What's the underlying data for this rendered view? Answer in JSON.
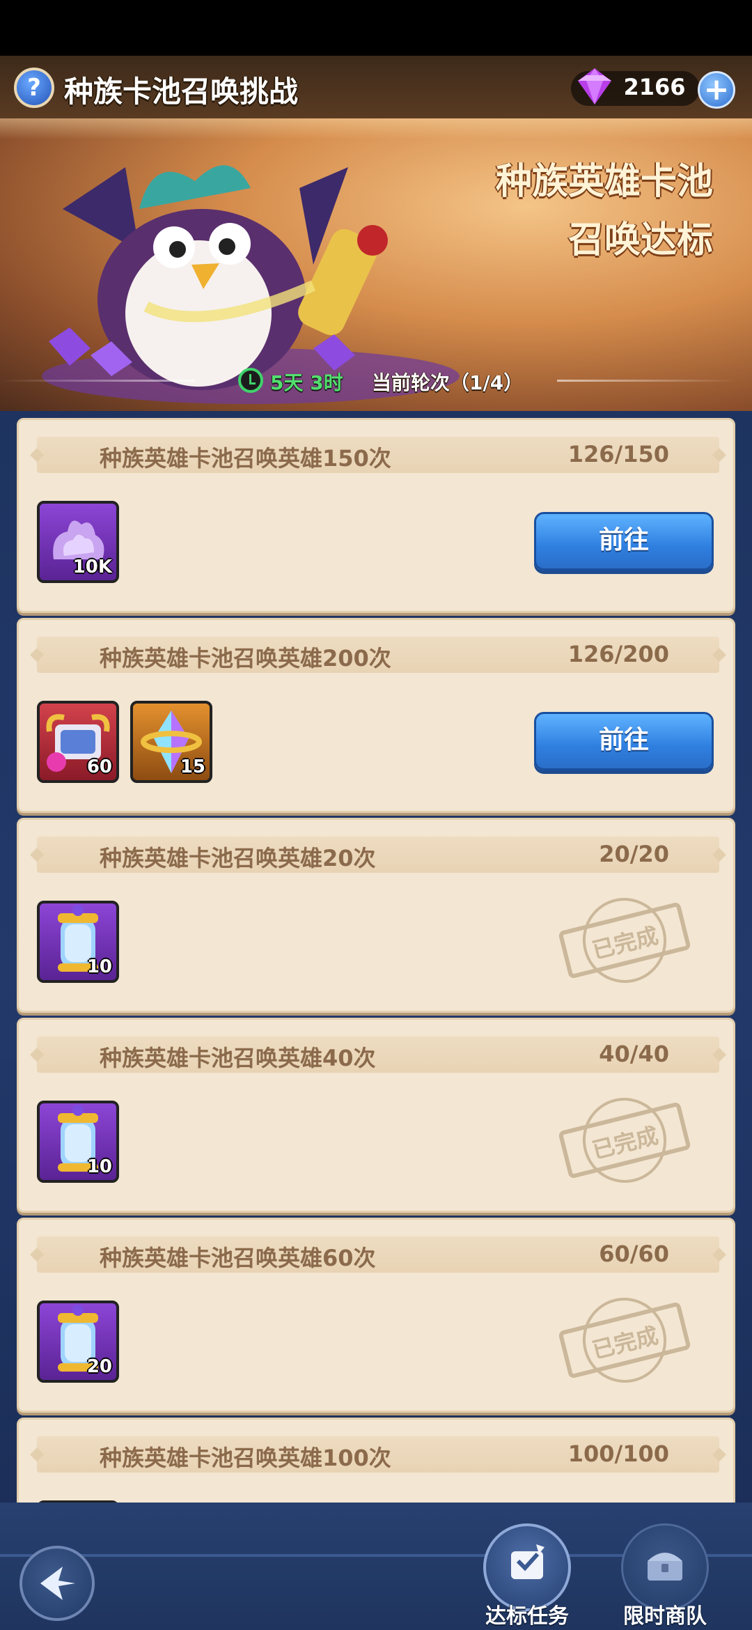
{
  "header": {
    "help_label": "?",
    "title": "种族卡池召唤挑战",
    "gem_count": "2166",
    "plus_label": "+"
  },
  "banner": {
    "title_line1": "种族英雄卡池",
    "title_line2": "召唤达标",
    "timer": "5天 3时",
    "round": "当前轮次（1/4）"
  },
  "tasks": [
    {
      "title": "种族英雄卡池召唤英雄150次",
      "progress": "126/150",
      "rewards": [
        {
          "icon": "purple-essence-icon",
          "count": "10K",
          "frame": "purple"
        }
      ],
      "action": "前往",
      "status": "in-progress"
    },
    {
      "title": "种族英雄卡池召唤英雄200次",
      "progress": "126/200",
      "rewards": [
        {
          "icon": "armor-chest-icon",
          "count": "60",
          "frame": "red"
        },
        {
          "icon": "crystal-ring-icon",
          "count": "15",
          "frame": "orange"
        }
      ],
      "action": "前往",
      "status": "in-progress"
    },
    {
      "title": "种族英雄卡池召唤英雄20次",
      "progress": "20/20",
      "rewards": [
        {
          "icon": "summon-scroll-icon",
          "count": "10",
          "frame": "purple"
        }
      ],
      "stamp": "已完成",
      "status": "completed"
    },
    {
      "title": "种族英雄卡池召唤英雄40次",
      "progress": "40/40",
      "rewards": [
        {
          "icon": "summon-scroll-icon",
          "count": "10",
          "frame": "purple"
        }
      ],
      "stamp": "已完成",
      "status": "completed"
    },
    {
      "title": "种族英雄卡池召唤英雄60次",
      "progress": "60/60",
      "rewards": [
        {
          "icon": "summon-scroll-icon",
          "count": "20",
          "frame": "purple"
        }
      ],
      "stamp": "已完成",
      "status": "completed"
    },
    {
      "title": "种族英雄卡池召唤英雄100次",
      "progress": "100/100",
      "status": "completed"
    }
  ],
  "bottom_nav": {
    "back_icon": "back-arrow-icon",
    "tabs": [
      {
        "label": "达标任务",
        "icon": "quest-scroll-icon",
        "active": true
      },
      {
        "label": "限时商队",
        "icon": "treasure-chest-icon",
        "active": false
      }
    ]
  },
  "colors": {
    "go_button": "#2f7fe0",
    "card_bg": "#f3e6d2",
    "card_text": "#8b6a4b",
    "timer_green": "#52e06f",
    "nav_bg": "#1f355f"
  }
}
